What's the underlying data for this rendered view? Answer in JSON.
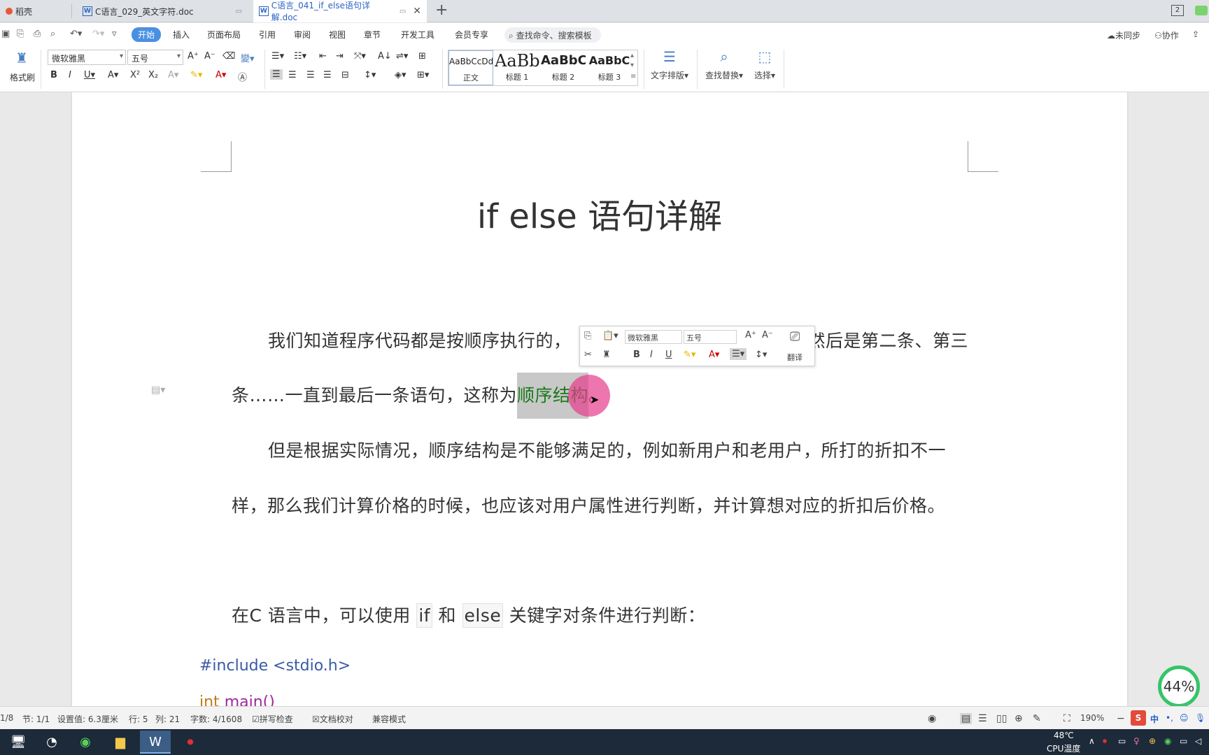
{
  "tabs": [
    {
      "label": "稻壳"
    },
    {
      "label": "C语言_029_英文字符.doc"
    },
    {
      "label": "C语言_041_if_else语句详解.doc",
      "active": true
    }
  ],
  "window_badge": "2",
  "menu": {
    "items": [
      "开始",
      "插入",
      "页面布局",
      "引用",
      "审阅",
      "视图",
      "章节",
      "开发工具",
      "会员专享"
    ],
    "search_placeholder": "查找命令、搜索模板",
    "sync": "未同步",
    "collab": "协作"
  },
  "toolbar": {
    "format_painter": "格式刷",
    "font_name": "微软雅黑",
    "font_size": "五号",
    "styles": [
      {
        "preview": "AaBbCcDd",
        "label": "正文"
      },
      {
        "preview": "AaBb",
        "label": "标题 1"
      },
      {
        "preview": "AaBbC",
        "label": "标题 2"
      },
      {
        "preview": "AaBbC",
        "label": "标题 3"
      }
    ],
    "text_layout": "文字排版",
    "find_replace": "查找替换",
    "select": "选择"
  },
  "document": {
    "title": "if else 语句详解",
    "p1_line1_a": "我们知道程序代码都是按顺序执行的，",
    "p1_line1_b": "然后是第二条、第三",
    "p1_line2_a": "条……一直到最后一条语句，这称为",
    "p1_line2_sel": "顺序结构",
    "p1_line2_end": "。",
    "p2_line1": "但是根据实际情况，顺序结构是不能够满足的，例如新用户和老用户，所打的折扣不一",
    "p2_line2": "样，那么我们计算价格的时候，也应该对用户属性进行判断，并计算想对应的折扣后价格。",
    "p3_a": "在C 语言中，可以使用 ",
    "p3_if": "if",
    "p3_and": " 和 ",
    "p3_else": "else",
    "p3_b": " 关键字对条件进行判断：",
    "code_include": "#include <stdio.h>",
    "code_int": "int",
    "code_main": "main()"
  },
  "mini_toolbar": {
    "font_name": "微软雅黑",
    "font_size": "五号",
    "translate": "翻译"
  },
  "perf_percent": "44%",
  "status": {
    "page": "1/8",
    "section": "节: 1/1",
    "setting": "设置值: 6.3厘米",
    "row": "行: 5",
    "col": "列: 21",
    "words": "字数: 4/1608",
    "spell": "拼写检查",
    "proof": "文档校对",
    "compat": "兼容模式",
    "zoom": "190%"
  },
  "tray": {
    "temp": "48℃",
    "temp_label": "CPU温度",
    "ime": "中"
  }
}
